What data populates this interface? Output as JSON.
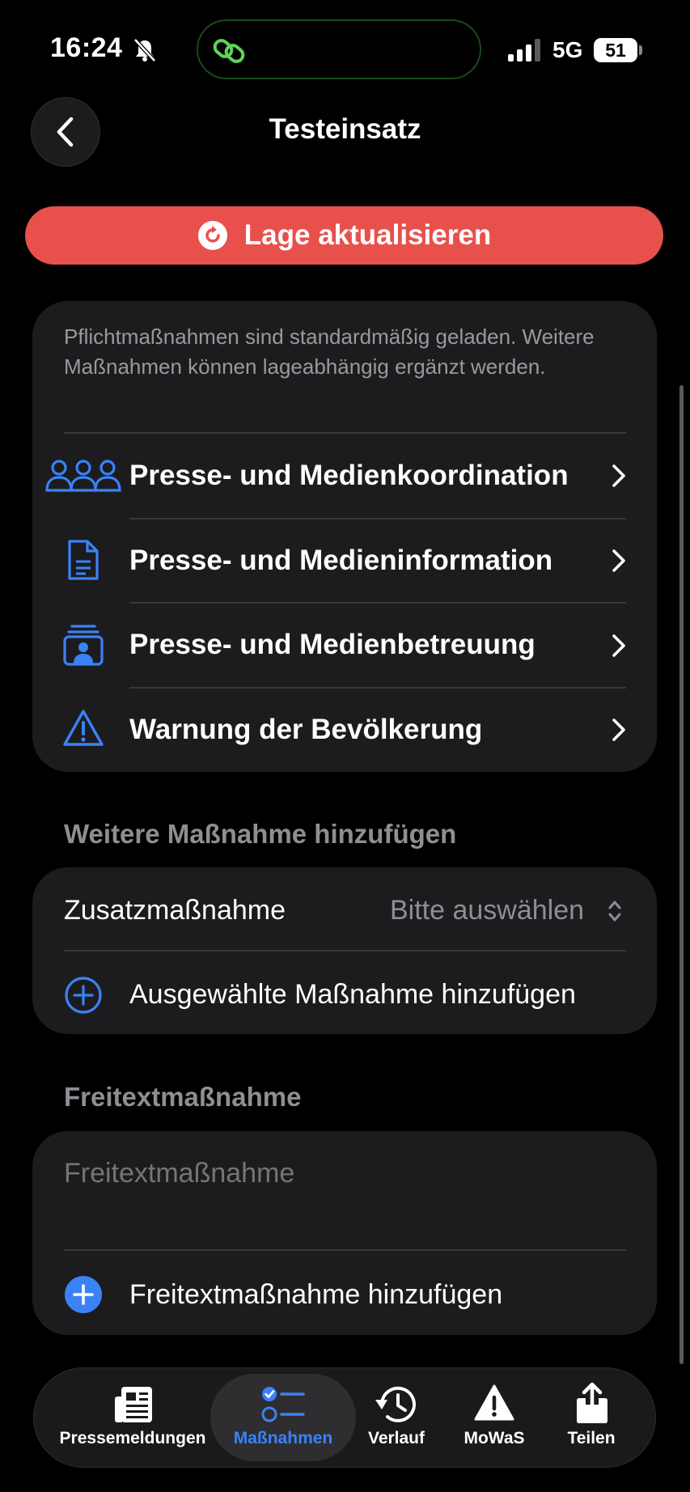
{
  "status_bar": {
    "time": "16:24",
    "network": "5G",
    "battery": "51"
  },
  "header": {
    "title": "Testeinsatz"
  },
  "update_button": {
    "label": "Lage aktualisieren"
  },
  "measures": {
    "info": "Pflichtmaßnahmen sind standardmäßig geladen. Weitere Maßnahmen können lageabhängig ergänzt werden.",
    "items": [
      {
        "label": "Presse- und Medienkoordination",
        "icon": "people-group-icon"
      },
      {
        "label": "Presse- und Medieninformation",
        "icon": "document-icon"
      },
      {
        "label": "Presse- und Medienbetreuung",
        "icon": "contact-card-icon"
      },
      {
        "label": "Warnung der Bevölkerung",
        "icon": "warning-triangle-icon"
      }
    ]
  },
  "additional": {
    "section_title": "Weitere Maßnahme hinzufügen",
    "picker_label": "Zusatzmaßnahme",
    "picker_value": "Bitte auswählen",
    "add_label": "Ausgewählte Maßnahme hinzufügen"
  },
  "freetext": {
    "section_title": "Freitextmaßnahme",
    "placeholder": "Freitextmaßnahme",
    "add_label": "Freitextmaßnahme hinzufügen"
  },
  "tabs": [
    {
      "label": "Pressemeldungen",
      "icon": "newspaper-icon",
      "active": false
    },
    {
      "label": "Maßnahmen",
      "icon": "checklist-icon",
      "active": true
    },
    {
      "label": "Verlauf",
      "icon": "history-clock-icon",
      "active": false
    },
    {
      "label": "MoWaS",
      "icon": "warning-icon",
      "active": false
    },
    {
      "label": "Teilen",
      "icon": "share-icon",
      "active": false
    }
  ],
  "colors": {
    "accent": "#3b82f6",
    "update_button": "#e8504c",
    "card": "#1c1c1e"
  }
}
